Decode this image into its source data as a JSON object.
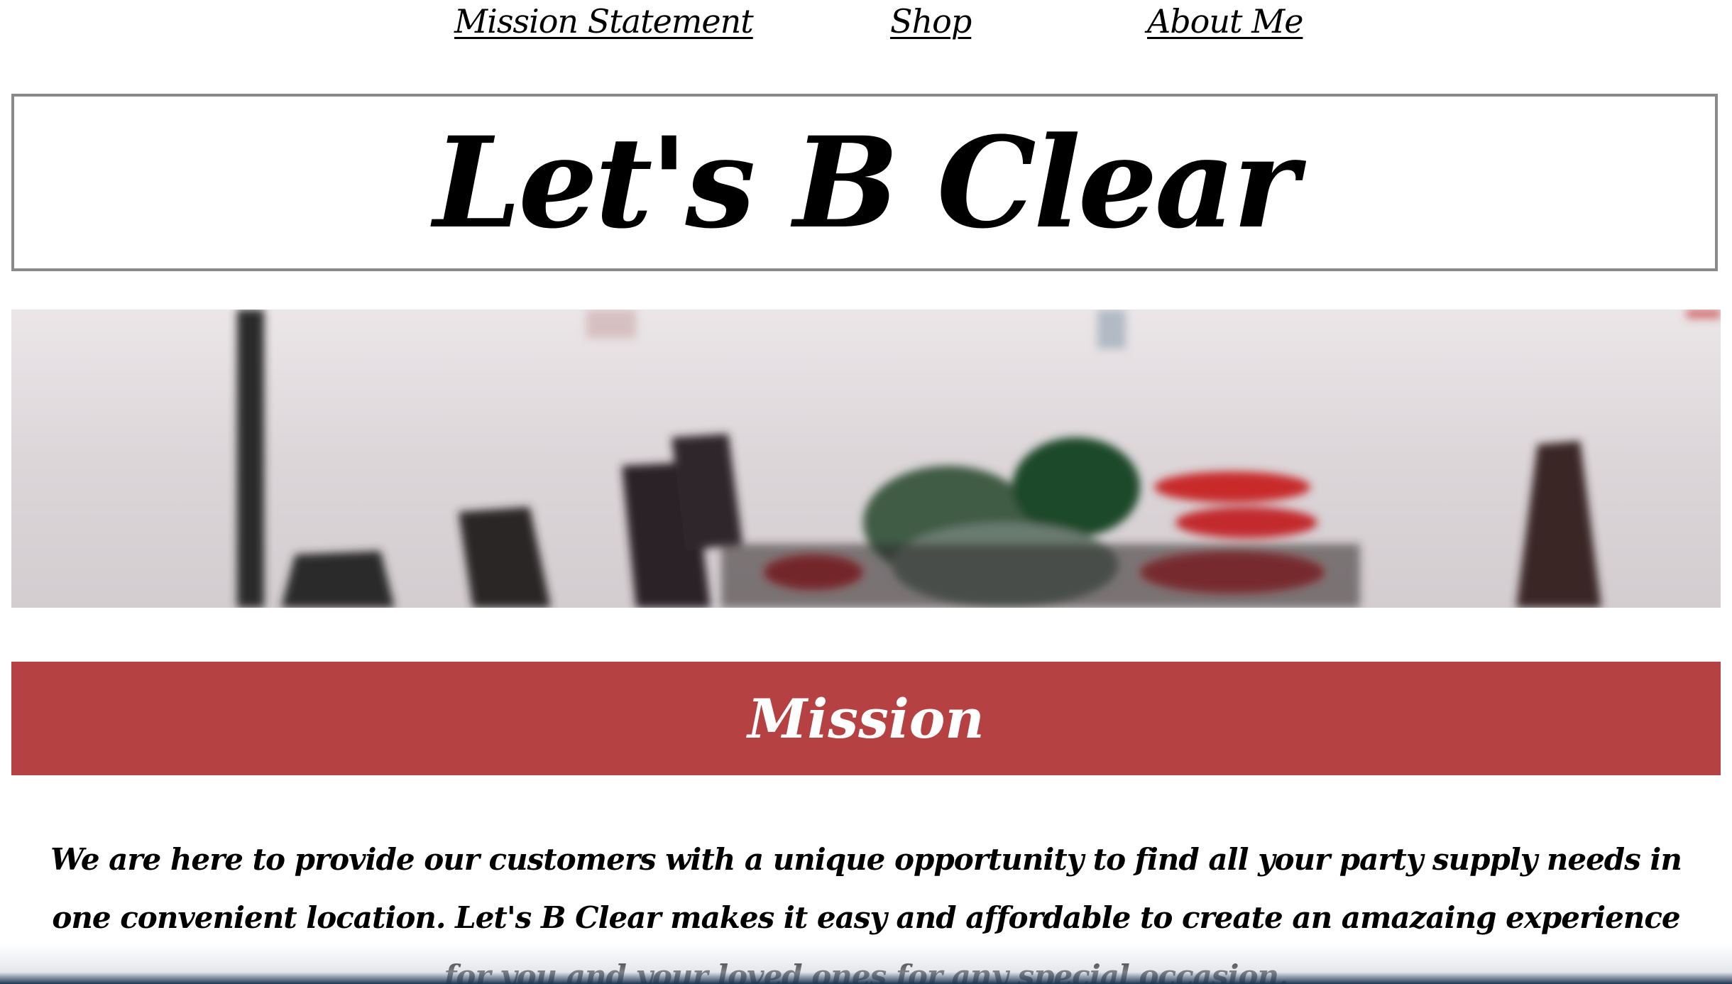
{
  "nav": {
    "items": [
      {
        "label": "Mission Statement"
      },
      {
        "label": "Shop"
      },
      {
        "label": "About Me"
      }
    ]
  },
  "header": {
    "title": "Let's B Clear"
  },
  "hero": {
    "description": ""
  },
  "mission": {
    "heading": "Mission",
    "body": "We are here to provide our customers with a unique opportunity to find all your party supply needs in one convenient location. Let's B Clear makes it easy and affordable to create an amazaing experience for you and your loved ones for any special occasion."
  },
  "colors": {
    "accent": "#b54143",
    "border": "#8a8a8a",
    "text": "#000000",
    "background": "#ffffff"
  }
}
